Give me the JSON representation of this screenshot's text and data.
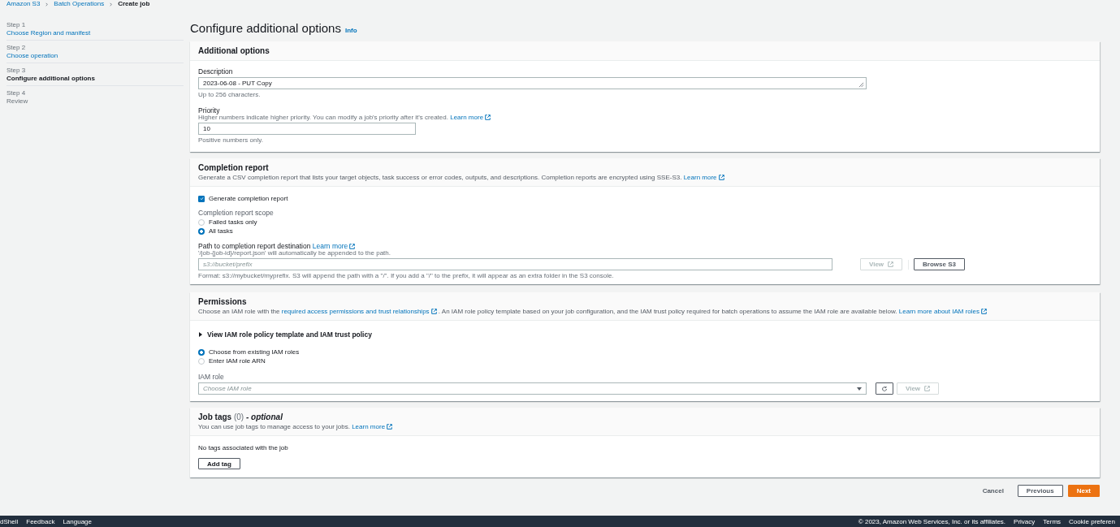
{
  "breadcrumb": [
    {
      "label": "Amazon S3",
      "link": true
    },
    {
      "label": "Batch Operations",
      "link": true
    },
    {
      "label": "Create job",
      "link": false
    }
  ],
  "steps": [
    {
      "step": "Step 1",
      "label": "Choose Region and manifest",
      "selected": false,
      "done": true
    },
    {
      "step": "Step 2",
      "label": "Choose operation",
      "selected": false,
      "done": true
    },
    {
      "step": "Step 3",
      "label": "Configure additional options",
      "selected": true,
      "done": false
    },
    {
      "step": "Step 4",
      "label": "Review",
      "selected": false,
      "done": false
    }
  ],
  "page_title": "Configure additional options",
  "info_link": "Info",
  "additional_options": {
    "title": "Additional options",
    "description": {
      "label": "Description",
      "value": "2023-06-08 - PUT Copy",
      "hint": "Up to 256 characters."
    },
    "priority": {
      "label": "Priority",
      "description": "Higher numbers indicate higher priority. You can modify a job's priority after it's created.",
      "learn_more": "Learn more",
      "value": "10",
      "hint": "Positive numbers only."
    }
  },
  "completion_report": {
    "title": "Completion report",
    "description": "Generate a CSV completion report that lists your target objects, task success or error codes, outputs, and descriptions. Completion reports are encrypted using SSE-S3.",
    "learn_more": "Learn more",
    "generate": {
      "label": "Generate completion report",
      "checked": true
    },
    "scope": {
      "label": "Completion report scope",
      "options": [
        {
          "label": "Failed tasks only",
          "selected": false
        },
        {
          "label": "All tasks",
          "selected": true
        }
      ]
    },
    "destination": {
      "label": "Path to completion report destination",
      "learn_more": "Learn more",
      "description": "'/job-{job-id}/report.json' will automatically be appended to the path.",
      "placeholder": "s3://bucket/prefix",
      "hint": "Format: s3://mybucket/myprefix. S3 will append the path with a \"/\". If you add a \"/\" to the prefix, it will appear as an extra folder in the S3 console.",
      "view_button": {
        "label": "View",
        "disabled": true
      },
      "browse_button": "Browse S3"
    }
  },
  "permissions": {
    "title": "Permissions",
    "description_1": "Choose an IAM role with the",
    "link_1": "required access permissions and trust relationships",
    "description_2": ". An IAM role policy template based on your job configuration, and the IAM trust policy required for batch operations to assume the IAM role are available below.",
    "link_2": "Learn more about IAM roles",
    "expander": {
      "label": "View IAM role policy template and IAM trust policy",
      "expanded": false
    },
    "options": [
      {
        "label": "Choose from existing IAM roles",
        "selected": true
      },
      {
        "label": "Enter IAM role ARN",
        "selected": false
      }
    ],
    "iam_role": {
      "label": "IAM role",
      "placeholder": "Choose IAM role"
    },
    "view_button": {
      "label": "View",
      "disabled": true
    }
  },
  "job_tags": {
    "title": "Job tags",
    "count": "(0)",
    "optional": "- optional",
    "description": "You can use job tags to manage access to your jobs.",
    "learn_more": "Learn more",
    "empty_text": "No tags associated with the job",
    "add_button": "Add tag"
  },
  "actions": {
    "cancel": "Cancel",
    "previous": "Previous",
    "next": "Next"
  },
  "footer": {
    "left": [
      "dShell",
      "Feedback",
      "Language"
    ],
    "copyright": "© 2023, Amazon Web Services, Inc. or its affiliates.",
    "links": [
      "Privacy",
      "Terms",
      "Cookie preferen"
    ]
  }
}
